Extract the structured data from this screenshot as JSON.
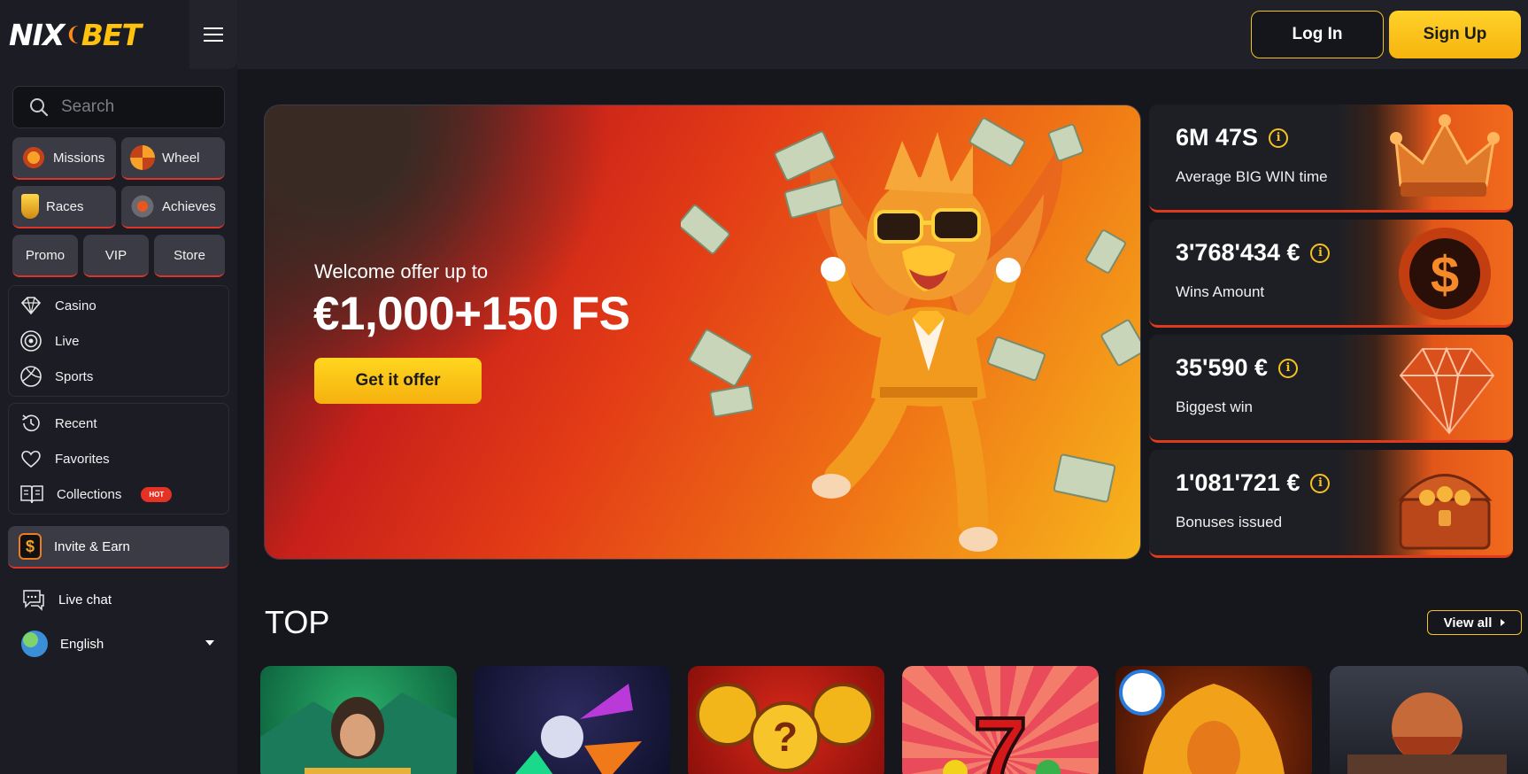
{
  "brand": {
    "logo_left": "NIX",
    "logo_right": "BET"
  },
  "header": {
    "login_label": "Log In",
    "signup_label": "Sign Up"
  },
  "search": {
    "placeholder": "Search"
  },
  "quick_links": [
    {
      "label": "Missions",
      "icon": "missions-icon"
    },
    {
      "label": "Wheel",
      "icon": "wheel-icon"
    },
    {
      "label": "Races",
      "icon": "trophy-icon"
    },
    {
      "label": "Achieves",
      "icon": "medal-icon"
    },
    {
      "label": "Promo"
    },
    {
      "label": "VIP"
    },
    {
      "label": "Store"
    }
  ],
  "nav_main": [
    {
      "label": "Casino",
      "icon": "casino-icon"
    },
    {
      "label": "Live",
      "icon": "live-icon"
    },
    {
      "label": "Sports",
      "icon": "sports-icon"
    }
  ],
  "nav_personal": [
    {
      "label": "Recent",
      "icon": "history-icon"
    },
    {
      "label": "Favorites",
      "icon": "heart-icon"
    },
    {
      "label": "Collections",
      "icon": "book-icon",
      "badge": "HOT"
    }
  ],
  "invite": {
    "label": "Invite & Earn"
  },
  "live_chat": {
    "label": "Live chat"
  },
  "language": {
    "label": "English"
  },
  "banner": {
    "subtitle": "Welcome offer up to",
    "title": "€1,000+150 FS",
    "button_label": "Get it offer"
  },
  "stats": [
    {
      "value": "6M 47S",
      "label": "Average BIG WIN time",
      "icon": "crown-icon"
    },
    {
      "value": "3'768'434 €",
      "label": "Wins Amount",
      "icon": "coin-icon"
    },
    {
      "value": "35'590 €",
      "label": "Biggest win",
      "icon": "gem-icon"
    },
    {
      "value": "1'081'721 €",
      "label": "Bonuses issued",
      "icon": "chest-icon"
    }
  ],
  "top_section": {
    "title": "TOP",
    "view_all_label": "View all"
  },
  "colors": {
    "accent": "#f7c21b",
    "brand_red": "#e03a1c",
    "bg": "#16171c",
    "sidebar": "#1c1d24"
  }
}
